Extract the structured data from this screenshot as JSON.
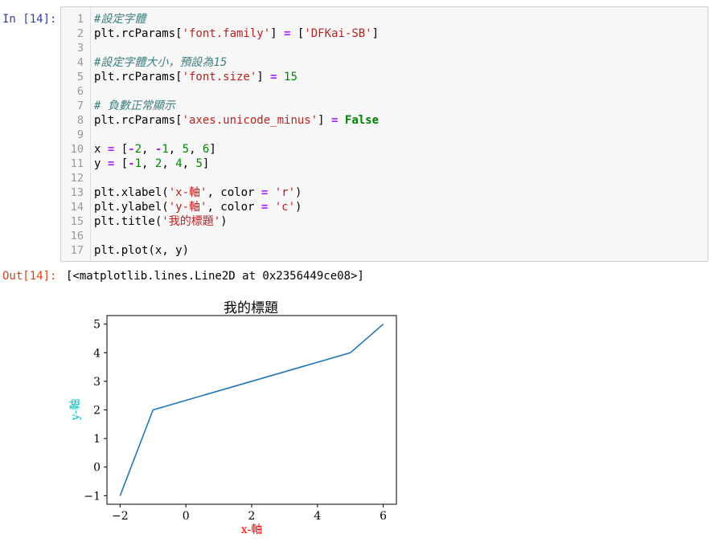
{
  "prompts": {
    "in": "In [14]:",
    "out": "Out[14]:"
  },
  "code": [
    {
      "n": "1",
      "tokens": [
        {
          "t": "#設定字體",
          "c": "cm"
        }
      ]
    },
    {
      "n": "2",
      "tokens": [
        {
          "t": "plt.rcParams[",
          "c": ""
        },
        {
          "t": "'font.family'",
          "c": "st"
        },
        {
          "t": "] ",
          "c": ""
        },
        {
          "t": "=",
          "c": "op"
        },
        {
          "t": " [",
          "c": ""
        },
        {
          "t": "'DFKai-SB'",
          "c": "st"
        },
        {
          "t": "]",
          "c": ""
        }
      ]
    },
    {
      "n": "3",
      "tokens": []
    },
    {
      "n": "4",
      "tokens": [
        {
          "t": "#設定字體大小，預設為15",
          "c": "cm"
        }
      ]
    },
    {
      "n": "5",
      "tokens": [
        {
          "t": "plt.rcParams[",
          "c": ""
        },
        {
          "t": "'font.size'",
          "c": "st"
        },
        {
          "t": "] ",
          "c": ""
        },
        {
          "t": "=",
          "c": "op"
        },
        {
          "t": " ",
          "c": ""
        },
        {
          "t": "15",
          "c": "nm"
        }
      ]
    },
    {
      "n": "6",
      "tokens": []
    },
    {
      "n": "7",
      "tokens": [
        {
          "t": "# 負數正常顯示",
          "c": "cm"
        }
      ]
    },
    {
      "n": "8",
      "tokens": [
        {
          "t": "plt.rcParams[",
          "c": ""
        },
        {
          "t": "'axes.unicode_minus'",
          "c": "st"
        },
        {
          "t": "] ",
          "c": ""
        },
        {
          "t": "=",
          "c": "op"
        },
        {
          "t": " ",
          "c": ""
        },
        {
          "t": "False",
          "c": "kw"
        }
      ]
    },
    {
      "n": "9",
      "tokens": []
    },
    {
      "n": "10",
      "tokens": [
        {
          "t": "x ",
          "c": ""
        },
        {
          "t": "=",
          "c": "op"
        },
        {
          "t": " [",
          "c": ""
        },
        {
          "t": "-",
          "c": "op"
        },
        {
          "t": "2",
          "c": "nm"
        },
        {
          "t": ", ",
          "c": ""
        },
        {
          "t": "-",
          "c": "op"
        },
        {
          "t": "1",
          "c": "nm"
        },
        {
          "t": ", ",
          "c": ""
        },
        {
          "t": "5",
          "c": "nm"
        },
        {
          "t": ", ",
          "c": ""
        },
        {
          "t": "6",
          "c": "nm"
        },
        {
          "t": "]",
          "c": ""
        }
      ]
    },
    {
      "n": "11",
      "tokens": [
        {
          "t": "y ",
          "c": ""
        },
        {
          "t": "=",
          "c": "op"
        },
        {
          "t": " [",
          "c": ""
        },
        {
          "t": "-",
          "c": "op"
        },
        {
          "t": "1",
          "c": "nm"
        },
        {
          "t": ", ",
          "c": ""
        },
        {
          "t": "2",
          "c": "nm"
        },
        {
          "t": ", ",
          "c": ""
        },
        {
          "t": "4",
          "c": "nm"
        },
        {
          "t": ", ",
          "c": ""
        },
        {
          "t": "5",
          "c": "nm"
        },
        {
          "t": "]",
          "c": ""
        }
      ]
    },
    {
      "n": "12",
      "tokens": []
    },
    {
      "n": "13",
      "tokens": [
        {
          "t": "plt.xlabel(",
          "c": ""
        },
        {
          "t": "'x-軸'",
          "c": "st"
        },
        {
          "t": ", color ",
          "c": ""
        },
        {
          "t": "=",
          "c": "op"
        },
        {
          "t": " ",
          "c": ""
        },
        {
          "t": "'r'",
          "c": "st"
        },
        {
          "t": ")",
          "c": ""
        }
      ]
    },
    {
      "n": "14",
      "tokens": [
        {
          "t": "plt.ylabel(",
          "c": ""
        },
        {
          "t": "'y-軸'",
          "c": "st"
        },
        {
          "t": ", color ",
          "c": ""
        },
        {
          "t": "=",
          "c": "op"
        },
        {
          "t": " ",
          "c": ""
        },
        {
          "t": "'c'",
          "c": "st"
        },
        {
          "t": ")",
          "c": ""
        }
      ]
    },
    {
      "n": "15",
      "tokens": [
        {
          "t": "plt.title(",
          "c": ""
        },
        {
          "t": "'我的標題'",
          "c": "st"
        },
        {
          "t": ")",
          "c": ""
        }
      ]
    },
    {
      "n": "16",
      "tokens": []
    },
    {
      "n": "17",
      "tokens": [
        {
          "t": "plt.plot(x, y)",
          "c": ""
        }
      ]
    }
  ],
  "output_text": "[<matplotlib.lines.Line2D at 0x2356449ce08>]",
  "chart_data": {
    "type": "line",
    "title": "我的標題",
    "xlabel": "x-軸",
    "ylabel": "y-軸",
    "xlabel_color": "#ff0000",
    "ylabel_color": "#00bfbf",
    "line_color": "#1f77b4",
    "x": [
      -2,
      -1,
      5,
      6
    ],
    "y": [
      -1,
      2,
      4,
      5
    ],
    "xlim": [
      -2.4,
      6.4
    ],
    "ylim": [
      -1.3,
      5.3
    ],
    "xticks": [
      -2,
      0,
      2,
      4,
      6
    ],
    "yticks": [
      -1,
      0,
      1,
      2,
      3,
      4,
      5
    ],
    "grid": false
  }
}
